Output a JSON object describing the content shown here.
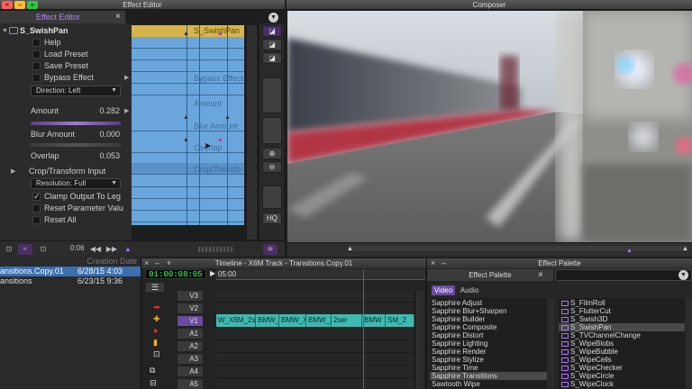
{
  "windows": {
    "effect_editor_title": "Effect Editor",
    "composer_title": "Composer",
    "effect_palette_title": "Effect Palette"
  },
  "effect_editor": {
    "tab_label": "Effect Editor",
    "effect_name": "S_SwishPan",
    "rows": [
      {
        "label": "Help",
        "checked": false
      },
      {
        "label": "Load Preset",
        "checked": false
      },
      {
        "label": "Save Preset",
        "checked": false
      },
      {
        "label": "Bypass Effect",
        "checked": false
      }
    ],
    "direction": "Direction: Left",
    "amount_label": "Amount",
    "amount_value": "0.282",
    "blur_label": "Blur Amount",
    "blur_value": "0.000",
    "overlap_label": "Overlap",
    "overlap_value": "0.053",
    "crop_label": "Crop/Transform Input",
    "resolution": "Resolution: Full",
    "clamp_label": "Clamp Output To Leg",
    "reset_param_label": "Reset Parameter Valu",
    "reset_all_label": "Reset All",
    "kf_labels": [
      "S_SwishPan",
      "Bypass Effect",
      "Amount",
      "Blur Amount",
      "Overlap",
      "Crop/Transfo"
    ],
    "timecode": "0:06",
    "hq": "HQ"
  },
  "bin": {
    "header_partial": "Creation Date",
    "items": [
      {
        "name": "ansitions.Copy.01",
        "date": "6/28/15 4:03"
      },
      {
        "name": "ansitions",
        "date": "6/23/15 9:36"
      }
    ]
  },
  "timeline": {
    "title": "Timeline - X6M Track - Transitions.Copy.01",
    "timecode": "01:00:08:05",
    "ruler_label": "05:00",
    "tracks": [
      "V3",
      "V2",
      "V1",
      "A1",
      "A2",
      "A3",
      "A4",
      "A5"
    ],
    "clips": [
      "W_X6M_2ser",
      "BMW_",
      "BMW_X",
      "BMW_X",
      "2ser",
      "BMW",
      "SM_2"
    ]
  },
  "effect_palette": {
    "title": "Effect Palette",
    "tabs": [
      "Video",
      "Audio"
    ],
    "categories": [
      "Sapphire Adjust",
      "Sapphire Blur+Sharpen",
      "Sapphire Builder",
      "Sapphire Composite",
      "Sapphire Distort",
      "Sapphire Lighting",
      "Sapphire Render",
      "Sapphire Stylize",
      "Sapphire Time",
      "Sapphire Transitions",
      "Sawtooth Wipe"
    ],
    "effects": [
      "S_FilmRoll",
      "S_FlutterCut",
      "S_Swish3D",
      "S_SwishPan",
      "S_TVChannelChange",
      "S_WipeBlobs",
      "S_WipeBubble",
      "S_WipeCells",
      "S_WipeChecker",
      "S_WipeCircle",
      "S_WipeClock"
    ]
  },
  "colors": {
    "accent": "#a070ff",
    "keyframe_blue": "#6aa6dc",
    "clip_teal": "#3fb9b0",
    "timecode_green": "#3cff5a"
  }
}
